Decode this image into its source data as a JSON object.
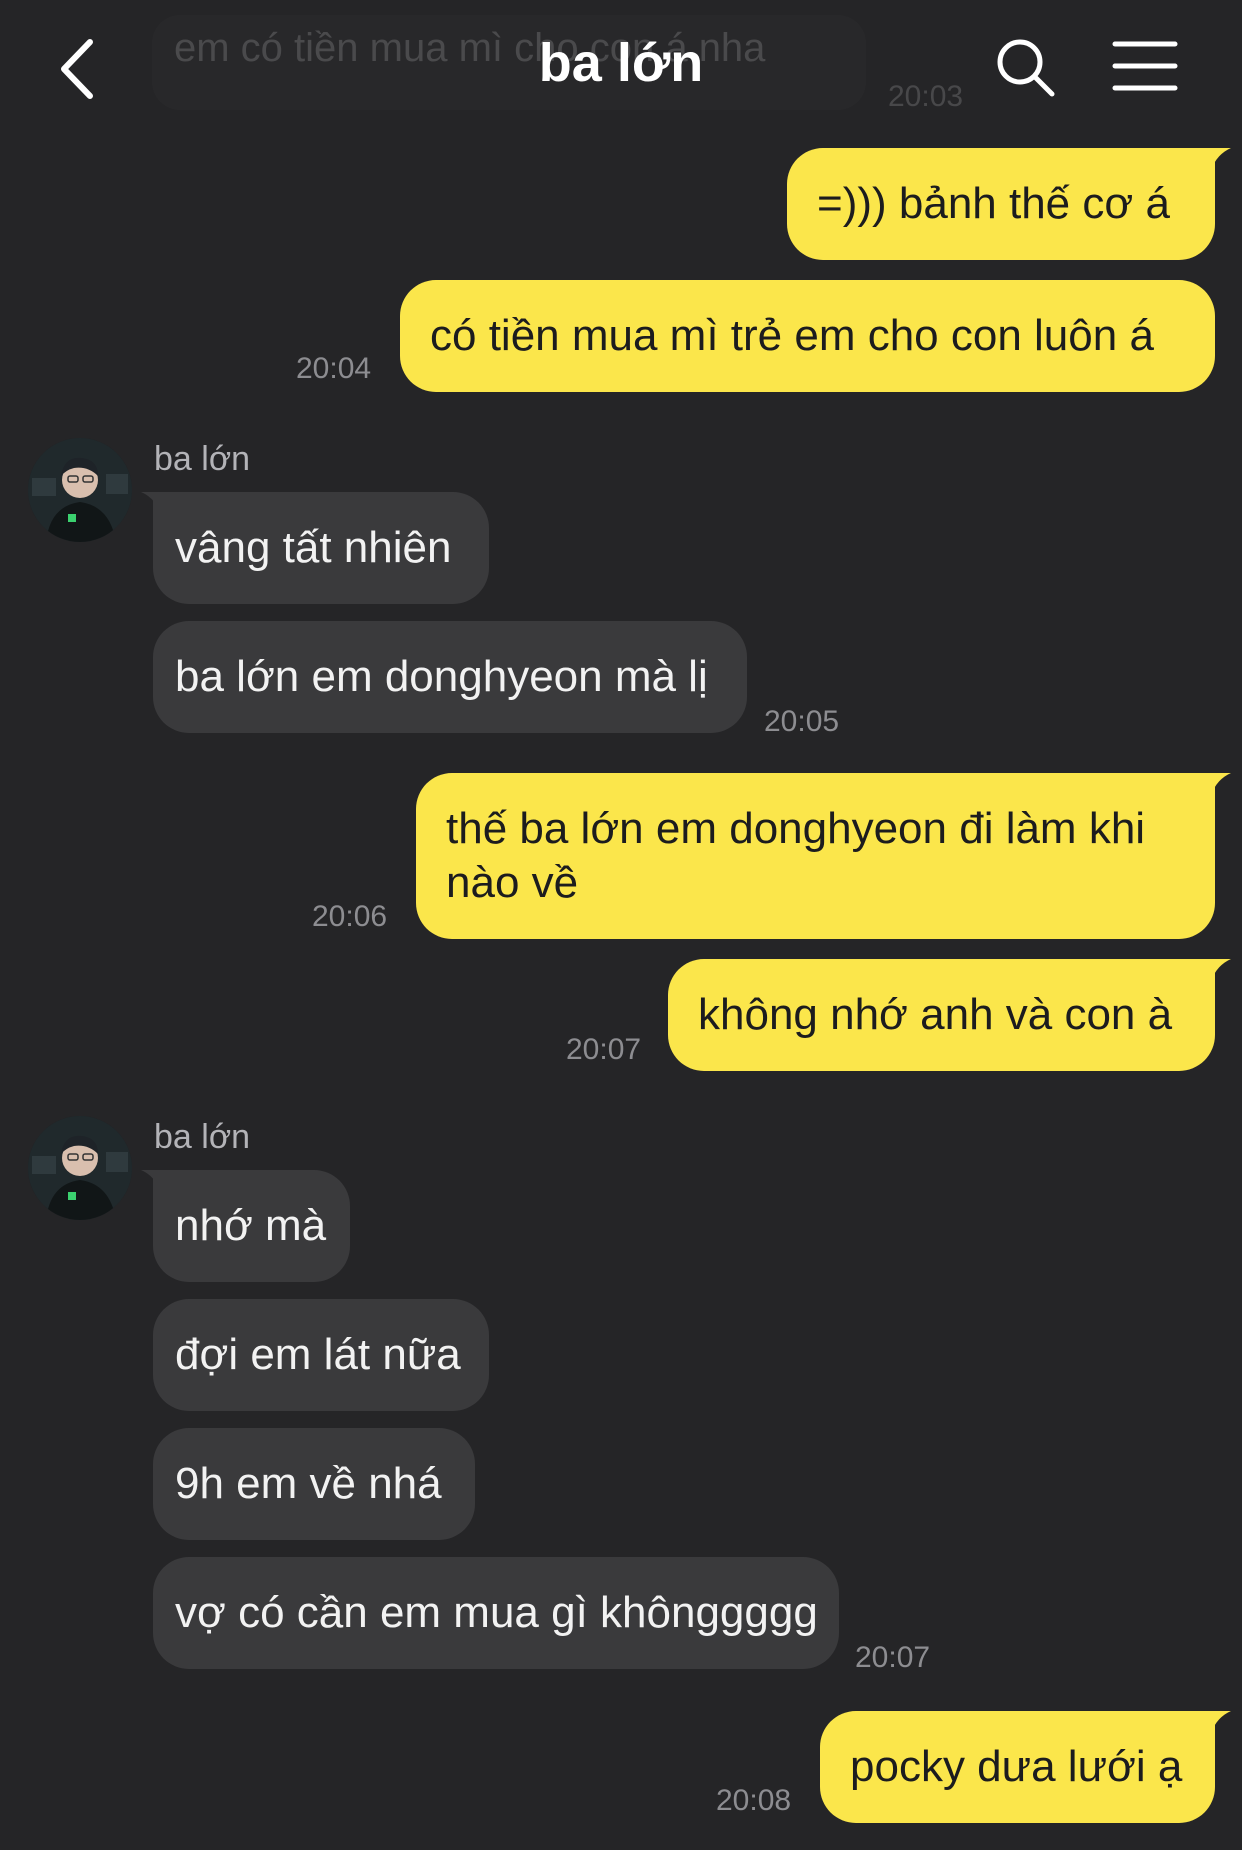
{
  "header": {
    "title": "ba lớn",
    "prev_message": "em có tiền mua mì cho con á nha",
    "prev_time": "20:03"
  },
  "messages": [
    {
      "text": "=))) bảnh thế cơ á"
    },
    {
      "text": "có tiền mua mì trẻ em cho con luôn á",
      "time": "20:04"
    },
    {
      "sender": "ba lớn"
    },
    {
      "text": "vâng tất nhiên"
    },
    {
      "text": "ba lớn em donghyeon mà lị",
      "time": "20:05"
    },
    {
      "line1": "thế ba lớn em donghyeon đi làm khi",
      "line2": "nào về",
      "time": "20:06"
    },
    {
      "text": "không nhớ anh và con à",
      "time": "20:07"
    },
    {
      "sender": "ba lớn"
    },
    {
      "text": "nhớ mà"
    },
    {
      "text": "đợi em lát nữa"
    },
    {
      "text": "9h em về nhá"
    },
    {
      "text": "vợ có cần em mua gì khônggggg",
      "time": "20:07"
    },
    {
      "text": "pocky dưa lưới ạ",
      "time": "20:08"
    }
  ],
  "colors": {
    "background": "#252527",
    "outgoing_bubble": "#fbe64b",
    "incoming_bubble": "#3a3a3c"
  },
  "icons": [
    "back-icon",
    "search-icon",
    "menu-icon",
    "avatar"
  ]
}
